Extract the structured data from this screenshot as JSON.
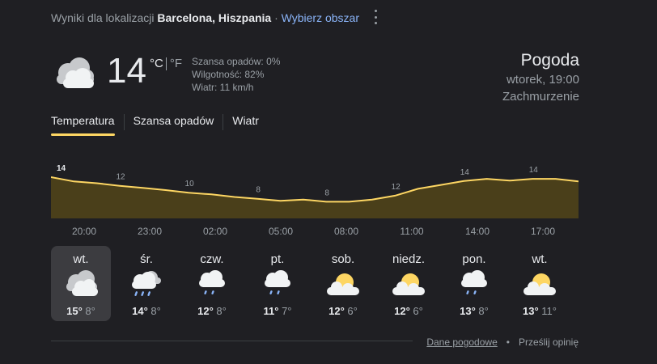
{
  "location": {
    "prefix": "Wyniki dla lokalizacji",
    "place": "Barcelona, Hiszpania",
    "separator": "·",
    "choose_area": "Wybierz obszar"
  },
  "current": {
    "icon": "cloudy-icon",
    "temperature": "14",
    "unit_c": "°C",
    "unit_f": "°F",
    "precip": "Szansa opadów: 0%",
    "humidity": "Wilgotność: 82%",
    "wind": "Wiatr: 11 km/h"
  },
  "header": {
    "title": "Pogoda",
    "datetime": "wtorek, 19:00",
    "condition": "Zachmurzenie"
  },
  "tabs": [
    {
      "label": "Temperatura",
      "active": true
    },
    {
      "label": "Szansa opadów",
      "active": false
    },
    {
      "label": "Wiatr",
      "active": false
    }
  ],
  "chart_data": {
    "type": "area",
    "x": [
      "19:00",
      "20:00",
      "21:00",
      "22:00",
      "23:00",
      "00:00",
      "01:00",
      "02:00",
      "03:00",
      "04:00",
      "05:00",
      "06:00",
      "07:00",
      "08:00",
      "09:00",
      "10:00",
      "11:00",
      "12:00",
      "13:00",
      "14:00",
      "15:00",
      "16:00",
      "17:00",
      "18:00"
    ],
    "values": [
      14,
      13,
      12.6,
      12,
      11.5,
      11,
      10.4,
      10,
      9.4,
      9,
      8.5,
      8.8,
      8.3,
      8.3,
      8.8,
      9.7,
      11.3,
      12.2,
      13.1,
      13.6,
      13.2,
      13.6,
      13.6,
      13
    ],
    "labels": [
      {
        "index": 0,
        "text": "14"
      },
      {
        "index": 3,
        "text": "12"
      },
      {
        "index": 6,
        "text": "10"
      },
      {
        "index": 9,
        "text": "8"
      },
      {
        "index": 12,
        "text": "8"
      },
      {
        "index": 15,
        "text": "12"
      },
      {
        "index": 18,
        "text": "14"
      },
      {
        "index": 21,
        "text": "14"
      }
    ],
    "line_color": "#fdd663",
    "fill_color": "#4a3f1a"
  },
  "time_labels": [
    "20:00",
    "23:00",
    "02:00",
    "05:00",
    "08:00",
    "11:00",
    "14:00",
    "17:00"
  ],
  "days": [
    {
      "name": "wt.",
      "icon": "cloudy-icon",
      "high": "15°",
      "low": "8°",
      "selected": true
    },
    {
      "name": "śr.",
      "icon": "rain-cloud-icon",
      "high": "14°",
      "low": "8°",
      "selected": false
    },
    {
      "name": "czw.",
      "icon": "showers-icon",
      "high": "12°",
      "low": "8°",
      "selected": false
    },
    {
      "name": "pt.",
      "icon": "showers-icon",
      "high": "11°",
      "low": "7°",
      "selected": false
    },
    {
      "name": "sob.",
      "icon": "partly-cloudy-icon",
      "high": "12°",
      "low": "6°",
      "selected": false
    },
    {
      "name": "niedz.",
      "icon": "partly-cloudy-icon",
      "high": "12°",
      "low": "6°",
      "selected": false
    },
    {
      "name": "pon.",
      "icon": "showers-icon",
      "high": "13°",
      "low": "8°",
      "selected": false
    },
    {
      "name": "wt.",
      "icon": "partly-cloudy-icon",
      "high": "13°",
      "low": "11°",
      "selected": false
    }
  ],
  "footer": {
    "data_link": "Dane pogodowe",
    "separator": "•",
    "feedback": "Prześlij opinię"
  }
}
